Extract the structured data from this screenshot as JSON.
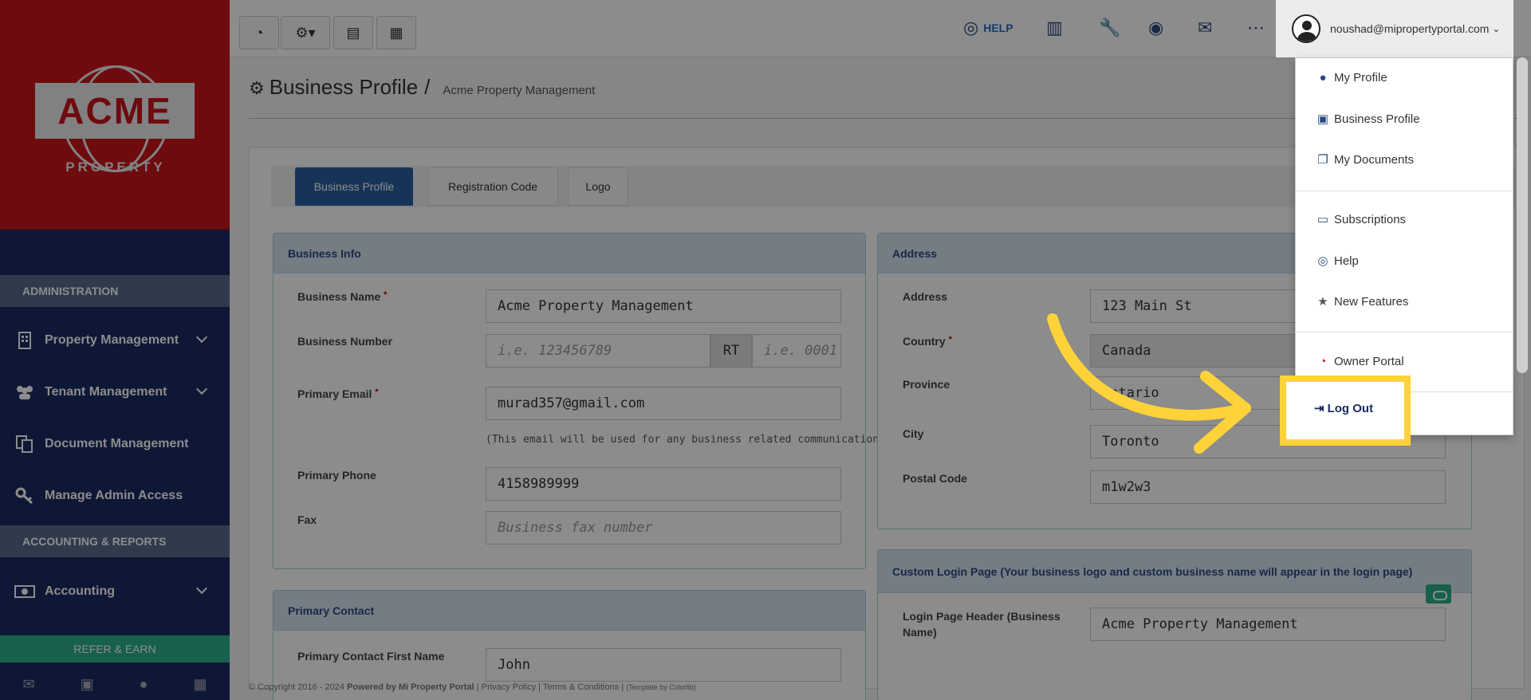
{
  "sidebar": {
    "logo_text": "ACME",
    "logo_sub": "PROPERTY",
    "section_admin": "ADMINISTRATION",
    "section_accounting": "ACCOUNTING & REPORTS",
    "items": [
      {
        "label": "Property Management",
        "icon": "building-icon"
      },
      {
        "label": "Tenant Management",
        "icon": "users-icon"
      },
      {
        "label": "Document Management",
        "icon": "documents-icon"
      },
      {
        "label": "Manage Admin Access",
        "icon": "key-icon"
      },
      {
        "label": "Accounting",
        "icon": "money-icon"
      }
    ],
    "refer_label": "REFER & EARN"
  },
  "topbar": {
    "help_label": "HELP",
    "user_email": "noushad@mipropertyportal.com"
  },
  "page": {
    "title": "Business Profile",
    "separator": "/",
    "subtitle": "Acme Property Management",
    "tabs": [
      "Business Profile",
      "Registration Code",
      "Logo"
    ]
  },
  "business_info": {
    "heading": "Business Info",
    "name_label": "Business Name",
    "name_value": "Acme Property Management",
    "number_label": "Business Number",
    "number_placeholder": "i.e. 123456789",
    "rt_label": "RT",
    "rt_placeholder": "i.e. 0001",
    "email_label": "Primary Email",
    "email_value": "murad357@gmail.com",
    "email_hint": "(This email will be used for any business related communication)",
    "phone_label": "Primary Phone",
    "phone_value": "4158989999",
    "fax_label": "Fax",
    "fax_placeholder": "Business fax number"
  },
  "address": {
    "heading": "Address",
    "address_label": "Address",
    "address_value": "123 Main St",
    "country_label": "Country",
    "country_value": "Canada",
    "province_label": "Province",
    "province_value": "Ontario",
    "city_label": "City",
    "city_value": "Toronto",
    "postal_label": "Postal Code",
    "postal_value": "m1w2w3"
  },
  "custom_login": {
    "heading": "Custom Login Page (Your business logo and custom business name will appear in the login page)",
    "header_label": "Login Page Header (Business Name)",
    "header_value": "Acme Property Management"
  },
  "primary_contact": {
    "heading": "Primary Contact",
    "first_name_label": "Primary Contact First Name",
    "first_name_value": "John"
  },
  "footer": {
    "copyright": "© Copyright 2016 - 2024",
    "powered": "Powered by Mi Property Portal",
    "privacy": "Privacy Policy",
    "terms": "Terms & Conditions",
    "template": "(Template by Colorlib)"
  },
  "user_menu": {
    "items": [
      {
        "label": "My Profile",
        "icon": "user-icon"
      },
      {
        "label": "Business Profile",
        "icon": "briefcase-icon"
      },
      {
        "label": "My Documents",
        "icon": "documents-icon"
      },
      {
        "label": "Subscriptions",
        "icon": "credit-card-icon"
      },
      {
        "label": "Help",
        "icon": "lifebuoy-icon"
      },
      {
        "label": "New Features",
        "icon": "star-icon"
      },
      {
        "label": "Owner Portal",
        "icon": "dashboard-icon"
      }
    ],
    "logout_label": "Log Out"
  },
  "colors": {
    "sidebar": "#1b2a63",
    "logo_red": "#c8141c",
    "accent_green": "#2bb08a",
    "tab_active": "#2a5fa0",
    "highlight": "#ffd23a"
  }
}
